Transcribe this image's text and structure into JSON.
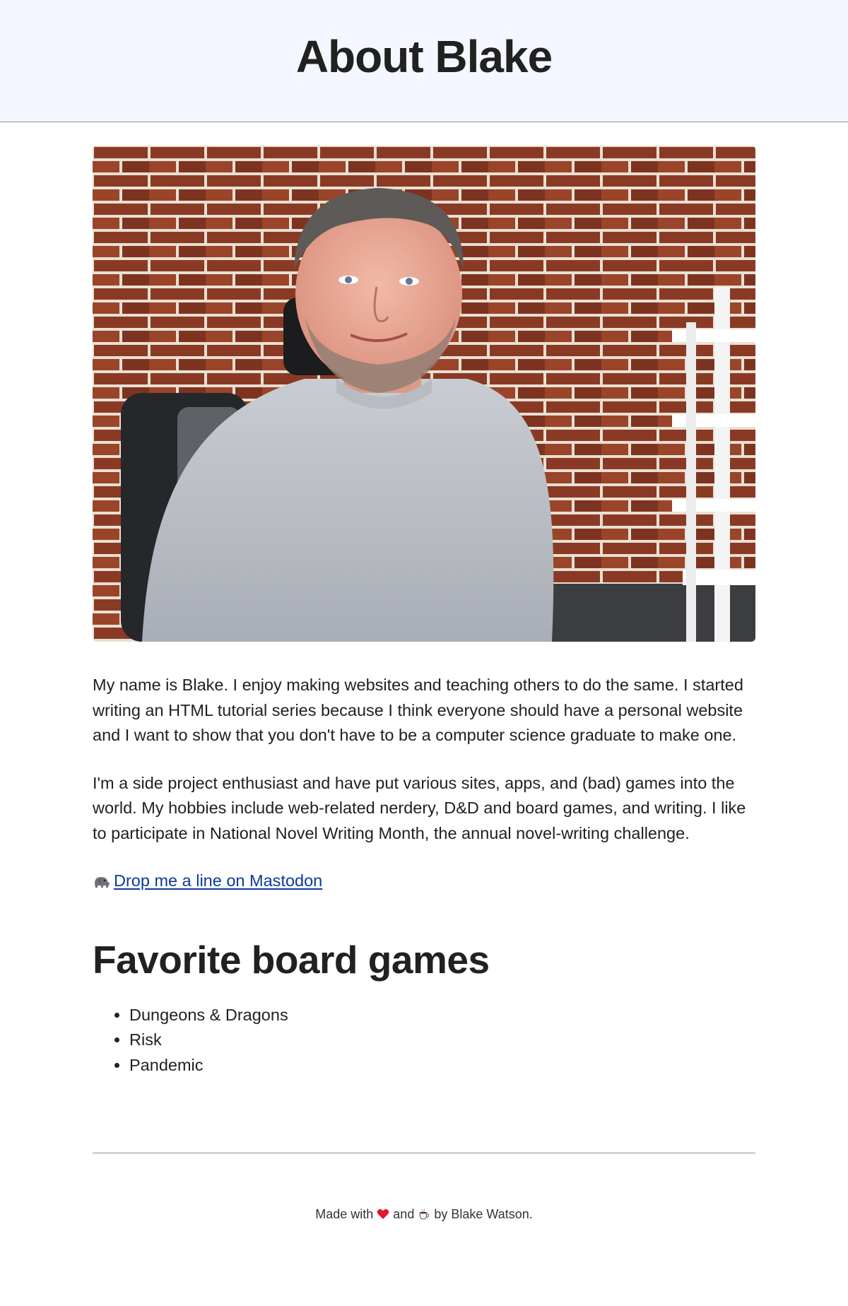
{
  "header": {
    "title": "About Blake"
  },
  "photo": {
    "alt": "Photo of Blake",
    "description_icon": "portrait-photo"
  },
  "bio": {
    "paragraph_1": "My name is Blake. I enjoy making websites and teaching others to do the same. I started writing an HTML tutorial series because I think everyone should have a personal website and I want to show that you don't have to be a computer science graduate to make one.",
    "paragraph_2": "I'm a side project enthusiast and have put various sites, apps, and (bad) games into the world. My hobbies include web-related nerdery, D&D and board games, and writing. I like to participate in National Novel Writing Month, the annual novel-writing challenge.",
    "mastodon_icon": "elephant-icon",
    "mastodon_link": "Drop me a line on Mastodon"
  },
  "board_games": {
    "title": "Favorite board games",
    "items": [
      "Dungeons & Dragons",
      "Risk",
      "Pandemic"
    ]
  },
  "footer": {
    "made_with": "Made with",
    "and": "and",
    "by": "by Blake Watson.",
    "heart_icon": "heart-icon",
    "coffee_icon": "coffee-icon"
  },
  "colors": {
    "header_bg": "#f4f7ff",
    "text": "#212121",
    "link": "#0b3a98",
    "divider": "#8e8e8e",
    "heart": "#e0182d"
  }
}
